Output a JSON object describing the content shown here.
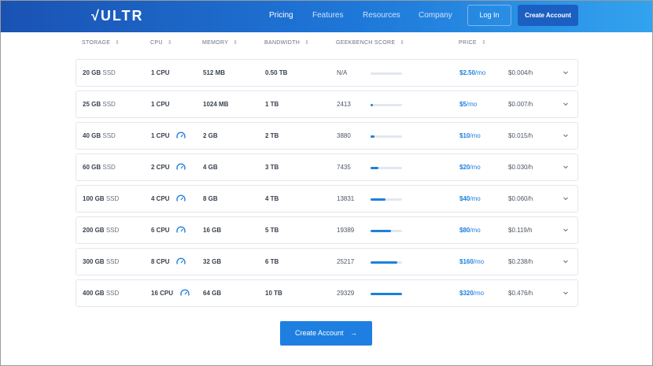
{
  "header": {
    "logo": "√ULTR",
    "nav": [
      "Pricing",
      "Features",
      "Resources",
      "Company"
    ],
    "active_nav": "Pricing",
    "login_label": "Log In",
    "create_account_label": "Create Account"
  },
  "table": {
    "columns": [
      "STORAGE",
      "CPU",
      "MEMORY",
      "BANDWIDTH",
      "GEEKBENCH SCORE",
      "PRICE"
    ],
    "rows": [
      {
        "storage_value": "20 GB",
        "storage_unit": "SSD",
        "cpu": "1 CPU",
        "gauge": false,
        "memory": "512 MB",
        "bandwidth": "0.50 TB",
        "score": "N/A",
        "score_pct": 0,
        "price_value": "$2.50",
        "price_unit": "/mo",
        "hourly": "$0.004/h"
      },
      {
        "storage_value": "25 GB",
        "storage_unit": "SSD",
        "cpu": "1 CPU",
        "gauge": false,
        "memory": "1024 MB",
        "bandwidth": "1 TB",
        "score": "2413",
        "score_pct": 8,
        "price_value": "$5",
        "price_unit": "/mo",
        "hourly": "$0.007/h"
      },
      {
        "storage_value": "40 GB",
        "storage_unit": "SSD",
        "cpu": "1 CPU",
        "gauge": true,
        "memory": "2 GB",
        "bandwidth": "2 TB",
        "score": "3880",
        "score_pct": 13,
        "price_value": "$10",
        "price_unit": "/mo",
        "hourly": "$0.015/h"
      },
      {
        "storage_value": "60 GB",
        "storage_unit": "SSD",
        "cpu": "2 CPU",
        "gauge": true,
        "memory": "4 GB",
        "bandwidth": "3 TB",
        "score": "7435",
        "score_pct": 25,
        "price_value": "$20",
        "price_unit": "/mo",
        "hourly": "$0.030/h"
      },
      {
        "storage_value": "100 GB",
        "storage_unit": "SSD",
        "cpu": "4 CPU",
        "gauge": true,
        "memory": "8 GB",
        "bandwidth": "4 TB",
        "score": "13831",
        "score_pct": 47,
        "price_value": "$40",
        "price_unit": "/mo",
        "hourly": "$0.060/h"
      },
      {
        "storage_value": "200 GB",
        "storage_unit": "SSD",
        "cpu": "6 CPU",
        "gauge": true,
        "memory": "16 GB",
        "bandwidth": "5 TB",
        "score": "19389",
        "score_pct": 66,
        "price_value": "$80",
        "price_unit": "/mo",
        "hourly": "$0.119/h"
      },
      {
        "storage_value": "300 GB",
        "storage_unit": "SSD",
        "cpu": "8 CPU",
        "gauge": true,
        "memory": "32 GB",
        "bandwidth": "6 TB",
        "score": "25217",
        "score_pct": 86,
        "price_value": "$160",
        "price_unit": "/mo",
        "hourly": "$0.238/h"
      },
      {
        "storage_value": "400 GB",
        "storage_unit": "SSD",
        "cpu": "16 CPU",
        "gauge": true,
        "memory": "64 GB",
        "bandwidth": "10 TB",
        "score": "29329",
        "score_pct": 100,
        "price_value": "$320",
        "price_unit": "/mo",
        "hourly": "$0.476/h"
      }
    ]
  },
  "cta": {
    "label": "Create Account",
    "arrow": "→"
  },
  "colors": {
    "accent": "#1e7fe0",
    "header_start": "#1a52b3",
    "header_end": "#33a3ee"
  }
}
